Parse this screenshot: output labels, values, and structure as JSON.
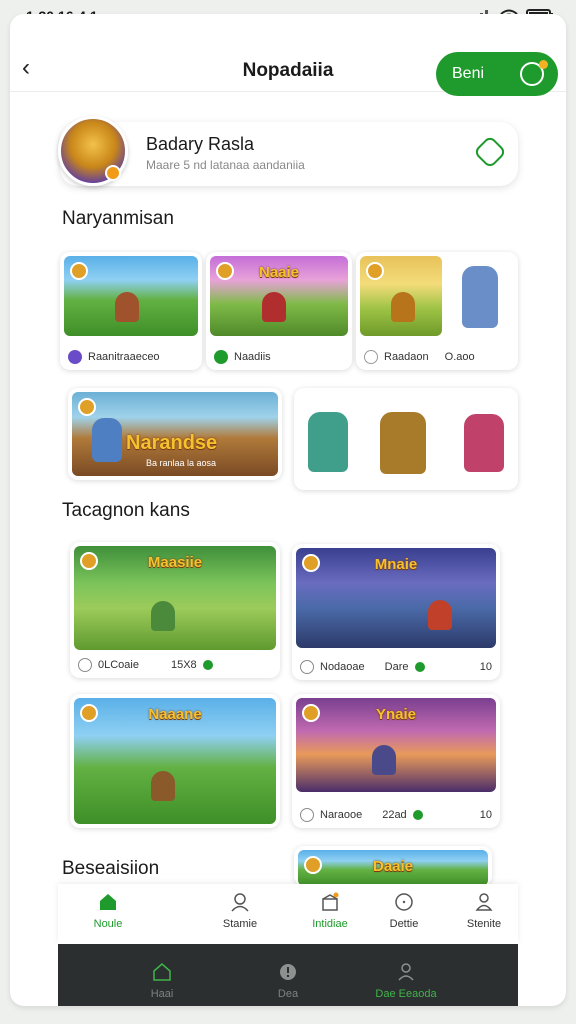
{
  "status_bar": {
    "time": "1:30 16:4 1",
    "signal_icon": "signal-icon",
    "wifi_icon": "wifi-icon",
    "battery_icon": "battery-icon"
  },
  "header": {
    "title": "Nopadaiia",
    "back_icon": "chevron-left-icon",
    "action_label": "Beni",
    "action_icon": "circle-check-icon"
  },
  "profile": {
    "name": "Badary Rasla",
    "subtitle": "Maare 5 nd latanaa aandaniia",
    "check_icon": "check-icon"
  },
  "sections": {
    "first": "Naryanmisan",
    "second": "Tacagnon kans",
    "third": "Beseaisiion"
  },
  "featured_row1": [
    {
      "label": "Raanitraaeceo",
      "value": "",
      "icon_color": "#6a4cc8"
    },
    {
      "label": "Naadiis",
      "value": "",
      "icon_color": "#1f9a2c",
      "title": "Naaie"
    },
    {
      "label": "Raadaon",
      "value": "O.aoo",
      "icon_color": "#9a9a9a"
    }
  ],
  "featured_row2": {
    "banner_title": "Narandse",
    "banner_subtitle": "Ba ranlaa la aosa"
  },
  "games_row1": [
    {
      "title": "Maasiie",
      "label": "0LCoaie",
      "value": "15X8",
      "icon_color": "#8a8a8a"
    },
    {
      "title": "Mnaie",
      "label": "Nodaoae",
      "value": "Dare",
      "extra": "10",
      "icon_color": "#8a8a8a"
    }
  ],
  "games_row2": [
    {
      "title": "Naaane",
      "label": "",
      "value": "",
      "icon_color": "#8a8a8a"
    },
    {
      "title": "Ynaie",
      "label": "Naraooe",
      "value": "22ad",
      "extra": "10",
      "icon_color": "#8a8a8a"
    }
  ],
  "games_row3": [
    {
      "title": "Daaie"
    }
  ],
  "tabs": [
    {
      "label": "Noule",
      "icon": "home-icon"
    },
    {
      "label": "Stamie",
      "icon": "user-icon"
    },
    {
      "label": "Intidiae",
      "icon": "gift-icon"
    },
    {
      "label": "Dettie",
      "icon": "clock-icon"
    },
    {
      "label": "Stenite",
      "icon": "person-icon"
    }
  ],
  "tabs_dark": [
    {
      "label": "Haai",
      "icon": "home-icon"
    },
    {
      "label": "Dea",
      "icon": "alert-icon"
    },
    {
      "label": "Dae Eeaoda",
      "icon": "user-icon"
    }
  ],
  "colors": {
    "accent": "#1f9a2c",
    "dark_bar": "#2b2f2f",
    "tile_badge": "#e0a028"
  }
}
